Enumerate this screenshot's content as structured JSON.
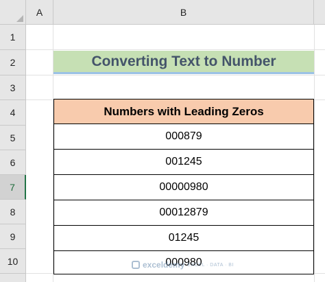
{
  "sheet": {
    "columns": [
      "A",
      "B"
    ],
    "rows": [
      "1",
      "2",
      "3",
      "4",
      "5",
      "6",
      "7",
      "8",
      "9",
      "10"
    ],
    "active_row": "7"
  },
  "title": "Converting Text to Number",
  "table": {
    "header": "Numbers with Leading Zeros",
    "values": [
      "000879",
      "001245",
      "00000980",
      "00012879",
      "01245",
      "000980"
    ]
  },
  "watermark": {
    "brand": "exceldemy",
    "tagline": "EXCEL · DATA · BI"
  },
  "colors": {
    "title_fill": "#c6e0b4",
    "title_text": "#44546a",
    "header_fill": "#f8cbad",
    "active_row_accent": "#217346"
  }
}
